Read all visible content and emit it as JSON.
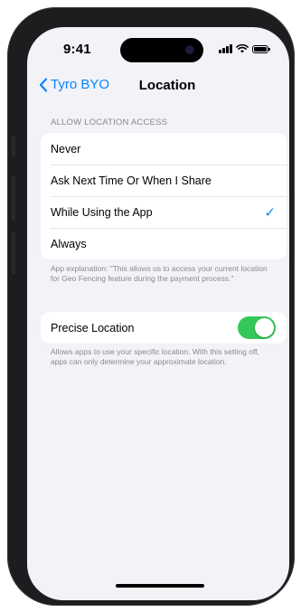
{
  "status_bar": {
    "time": "9:41"
  },
  "nav": {
    "back_label": "Tyro BYO",
    "title": "Location"
  },
  "location_access": {
    "header": "ALLOW LOCATION ACCESS",
    "options": [
      {
        "label": "Never",
        "selected": false
      },
      {
        "label": "Ask Next Time Or When I Share",
        "selected": false
      },
      {
        "label": "While Using the App",
        "selected": true
      },
      {
        "label": "Always",
        "selected": false
      }
    ],
    "checkmark": "✓",
    "explanation": "App explanation: \"This allows us to access your current location for Geo Fencing feature during the payment process.\""
  },
  "precise_location": {
    "label": "Precise Location",
    "enabled": true,
    "description": "Allows apps to use your specific location. With this setting off, apps can only determine your approximate location."
  },
  "colors": {
    "accent": "#0a84ff",
    "toggle_on": "#34c759",
    "background": "#f2f2f7"
  },
  "icons": {
    "back": "chevron-left-icon",
    "signal": "cellular-signal-icon",
    "wifi": "wifi-icon",
    "battery": "battery-icon",
    "selected": "checkmark-icon"
  }
}
